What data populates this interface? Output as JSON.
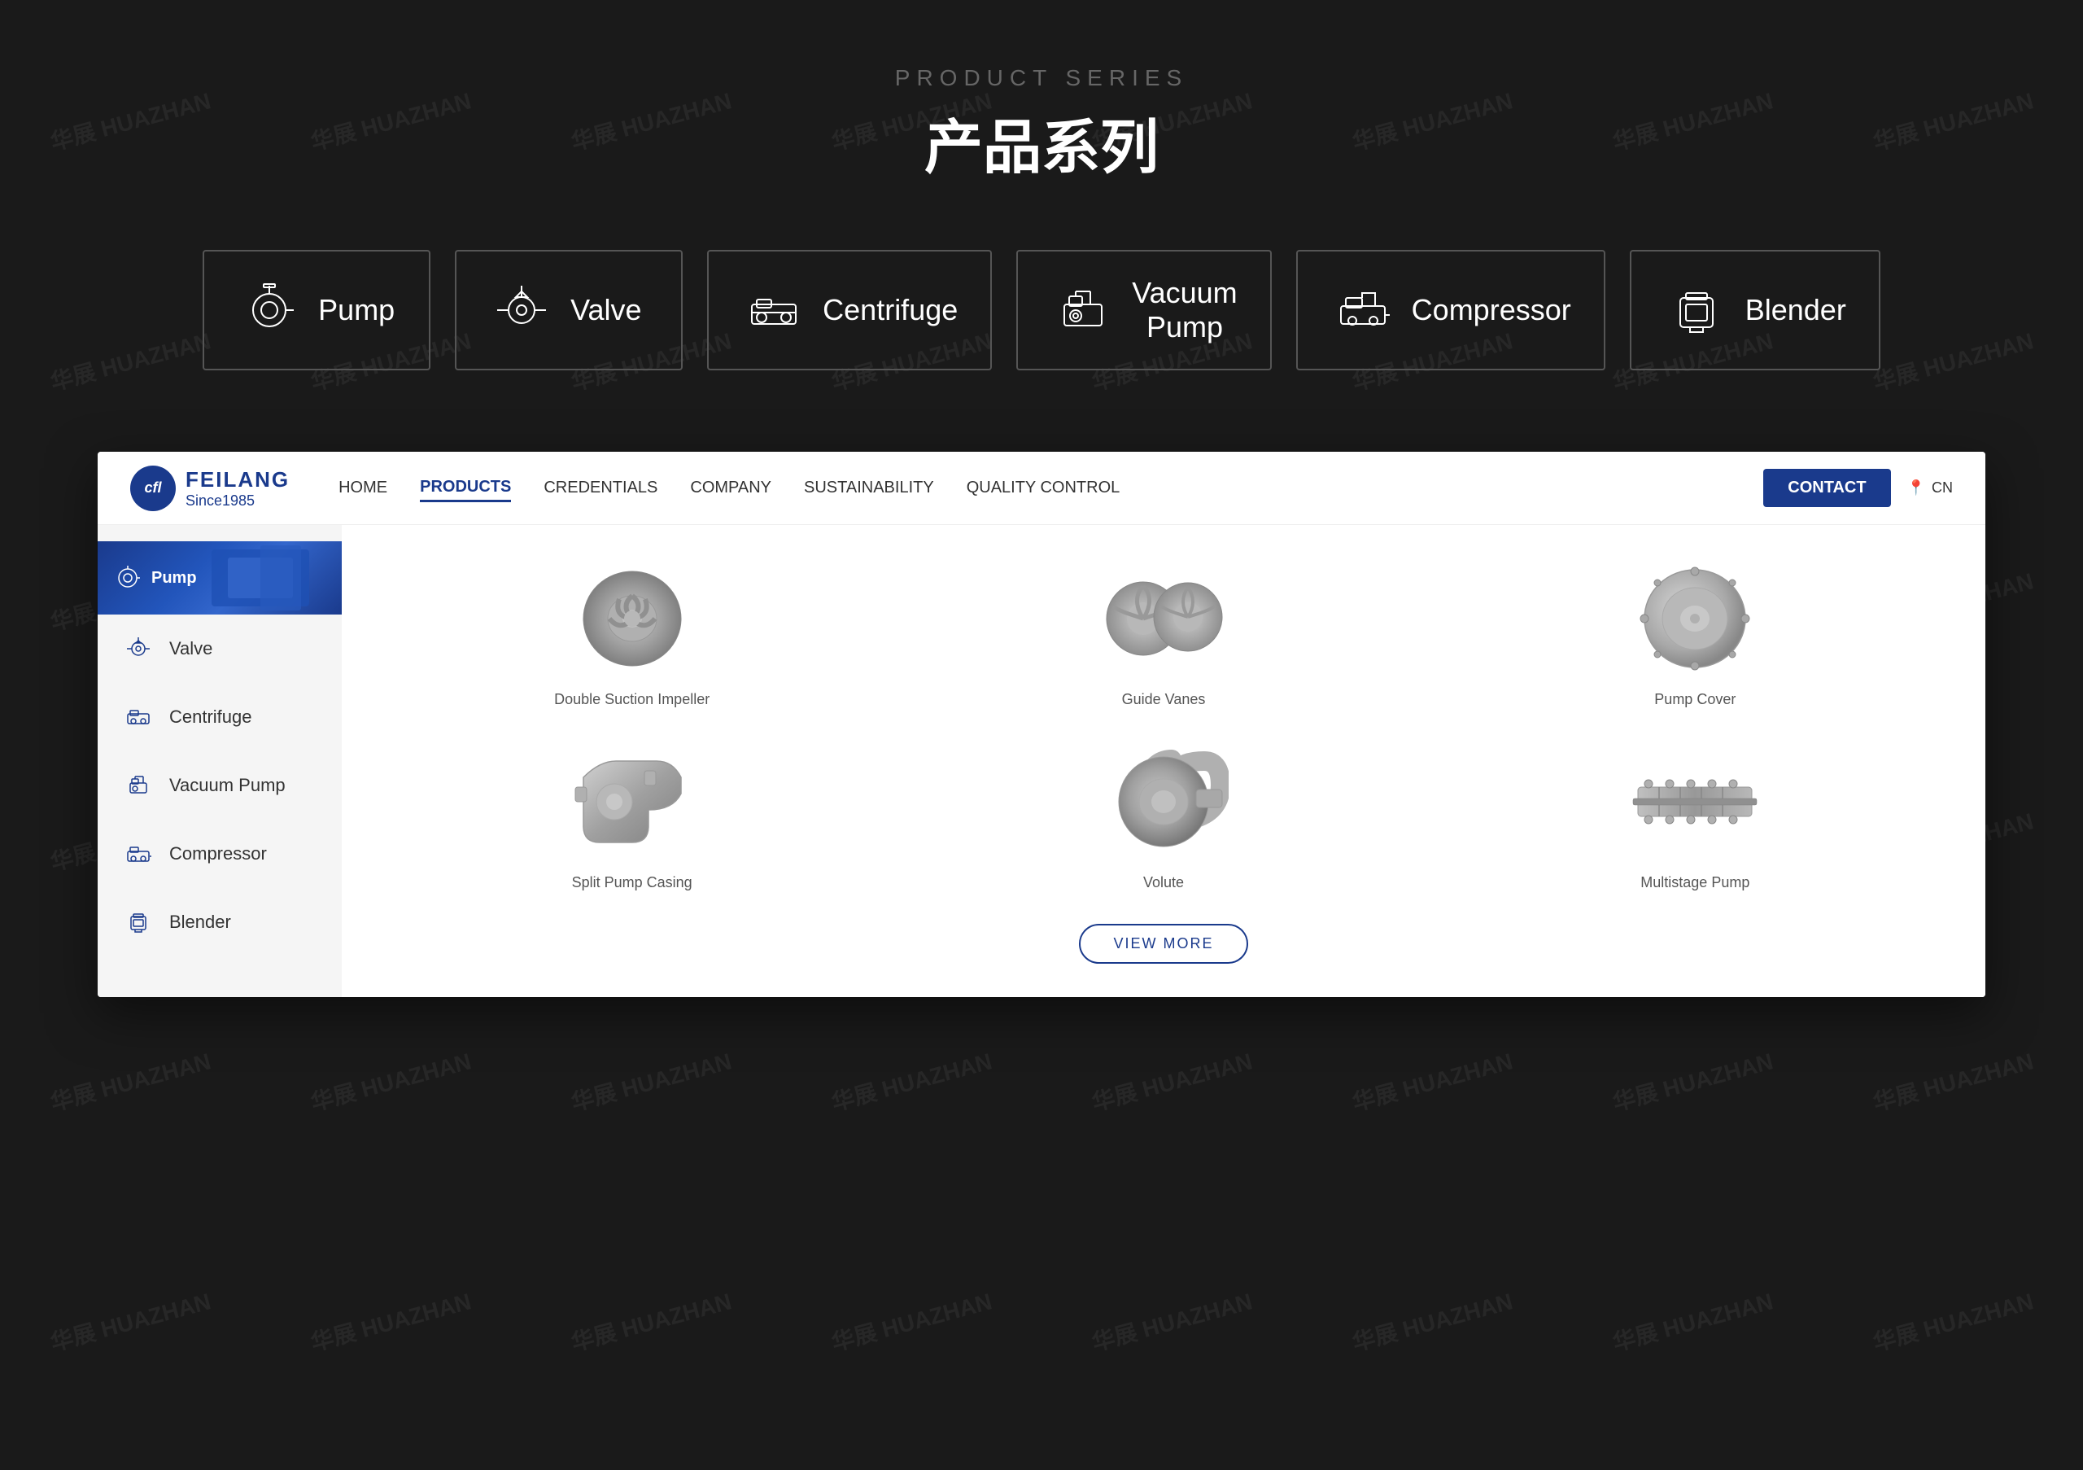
{
  "page": {
    "background_color": "#1a1a1a"
  },
  "top_section": {
    "subtitle": "PRODUCT SERIES",
    "title": "产品系列"
  },
  "category_cards": [
    {
      "id": "pump",
      "label": "Pump",
      "icon": "pump"
    },
    {
      "id": "valve",
      "label": "Valve",
      "icon": "valve"
    },
    {
      "id": "centrifuge",
      "label": "Centrifuge",
      "icon": "centrifuge"
    },
    {
      "id": "vacuum-pump",
      "label": "Vacuum\nPump",
      "icon": "vacuum-pump"
    },
    {
      "id": "compressor",
      "label": "Compressor",
      "icon": "compressor"
    },
    {
      "id": "blender",
      "label": "Blender",
      "icon": "blender"
    }
  ],
  "nav": {
    "logo_brand": "FEILANG",
    "logo_since": "Since1985",
    "logo_letters": "cfl",
    "links": [
      {
        "id": "home",
        "label": "HOME",
        "active": false
      },
      {
        "id": "products",
        "label": "PRODUCTS",
        "active": true
      },
      {
        "id": "credentials",
        "label": "CREDENTIALS",
        "active": false
      },
      {
        "id": "company",
        "label": "COMPANY",
        "active": false
      },
      {
        "id": "sustainability",
        "label": "SUSTAINABILITY",
        "active": false
      },
      {
        "id": "quality-control",
        "label": "QUALITY CONTROL",
        "active": false
      }
    ],
    "contact_label": "CONTACT",
    "lang_label": "CN"
  },
  "sidebar": {
    "items": [
      {
        "id": "pump",
        "label": "Pump",
        "active": true
      },
      {
        "id": "valve",
        "label": "Valve",
        "active": false
      },
      {
        "id": "centrifuge",
        "label": "Centrifuge",
        "active": false
      },
      {
        "id": "vacuum-pump",
        "label": "Vacuum Pump",
        "active": false
      },
      {
        "id": "compressor",
        "label": "Compressor",
        "active": false
      },
      {
        "id": "blender",
        "label": "Blender",
        "active": false
      }
    ]
  },
  "products": {
    "items": [
      {
        "id": "double-suction-impeller",
        "label": "Double Suction Impeller"
      },
      {
        "id": "guide-vanes",
        "label": "Guide Vanes"
      },
      {
        "id": "pump-cover",
        "label": "Pump Cover"
      },
      {
        "id": "split-pump-casing",
        "label": "Split Pump Casing"
      },
      {
        "id": "volute",
        "label": "Volute"
      },
      {
        "id": "multistage-pump",
        "label": "Multistage Pump"
      }
    ],
    "view_more_label": "VIEW MORE"
  },
  "watermark": {
    "text": "华展 HUAZHAN"
  }
}
